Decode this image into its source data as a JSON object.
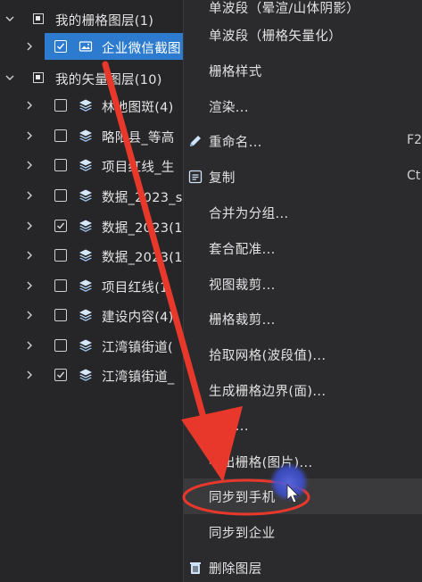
{
  "tree": {
    "raster_group": {
      "label": "我的栅格图层(1)",
      "children": [
        {
          "label": "企业微信截图",
          "checked": true,
          "selected": true
        }
      ]
    },
    "vector_group": {
      "label": "我的矢量图层(10)",
      "children": [
        {
          "label": "林地图斑(4)",
          "checked": false
        },
        {
          "label": "略阳县_等高",
          "checked": false
        },
        {
          "label": "项目红线_生",
          "checked": false
        },
        {
          "label": "数据_2023_s",
          "checked": false
        },
        {
          "label": "数据_2023(1",
          "checked": true
        },
        {
          "label": "数据_2023(1",
          "checked": false
        },
        {
          "label": "项目红线(1",
          "checked": false
        },
        {
          "label": "建设内容(4)",
          "checked": false
        },
        {
          "label": "江湾镇街道(",
          "checked": false
        },
        {
          "label": "江湾镇街道_",
          "checked": true
        }
      ]
    }
  },
  "menu": {
    "items": [
      {
        "label": "单波段（晕渲/山体阴影）",
        "shortcut": "",
        "icon": ""
      },
      {
        "label": "单波段（栅格矢量化）",
        "shortcut": "",
        "icon": ""
      },
      {
        "label": "栅格样式",
        "shortcut": "",
        "icon": ""
      },
      {
        "label": "渲染...",
        "shortcut": "",
        "icon": ""
      },
      {
        "label": "重命名...",
        "shortcut": "F2",
        "icon": "pencil-icon"
      },
      {
        "label": "复制",
        "shortcut": "Ct",
        "icon": "copy-icon"
      },
      {
        "label": "合并为分组...",
        "shortcut": "",
        "icon": ""
      },
      {
        "label": "套合配准...",
        "shortcut": "",
        "icon": ""
      },
      {
        "label": "视图裁剪...",
        "shortcut": "",
        "icon": ""
      },
      {
        "label": "栅格裁剪...",
        "shortcut": "",
        "icon": ""
      },
      {
        "label": "拾取网格(波段值)...",
        "shortcut": "",
        "icon": ""
      },
      {
        "label": "生成栅格边界(面)...",
        "shortcut": "",
        "icon": ""
      },
      {
        "label": "属性...",
        "shortcut": "",
        "icon": ""
      },
      {
        "label": "导出栅格(图片)...",
        "shortcut": "",
        "icon": ""
      },
      {
        "label": "同步到手机",
        "shortcut": "",
        "icon": ""
      },
      {
        "label": "同步到企业",
        "shortcut": "",
        "icon": ""
      },
      {
        "label": "删除图层",
        "shortcut": "",
        "icon": "trash-icon"
      }
    ]
  },
  "colors": {
    "selection": "#2d7bcf",
    "annotation_red": "#e8372b",
    "cursor_highlight": "#4a5bd8"
  }
}
